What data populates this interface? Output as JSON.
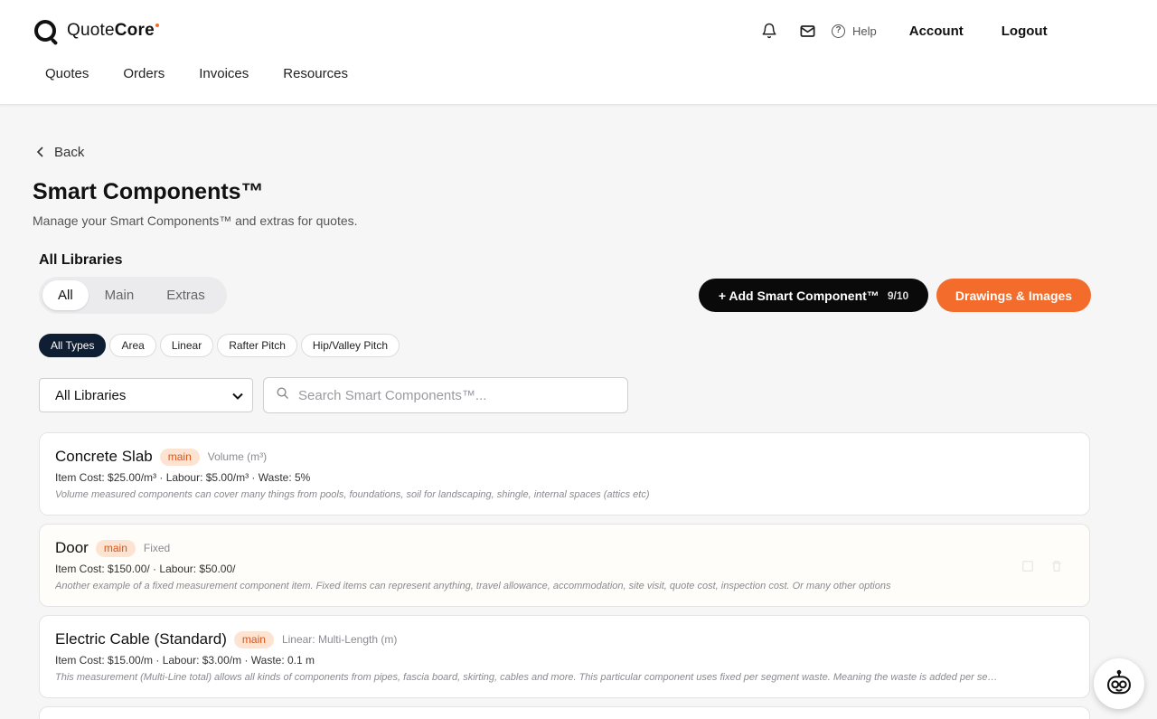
{
  "brand": {
    "name_light": "Quote",
    "name_bold": "Core"
  },
  "header": {
    "help_label": "Help",
    "account_label": "Account",
    "logout_label": "Logout"
  },
  "nav": [
    "Quotes",
    "Orders",
    "Invoices",
    "Resources"
  ],
  "page": {
    "back_label": "Back",
    "title": "Smart Components™",
    "subtitle": "Manage your Smart Components™ and extras for quotes.",
    "libraries_heading": "All Libraries"
  },
  "segment_tabs": [
    {
      "label": "All",
      "active": true
    },
    {
      "label": "Main",
      "active": false
    },
    {
      "label": "Extras",
      "active": false
    }
  ],
  "actions": {
    "add_label": "+ Add Smart Component™",
    "add_count": "9/10",
    "drawings_label": "Drawings & Images"
  },
  "type_filters": [
    {
      "label": "All Types",
      "active": true
    },
    {
      "label": "Area",
      "active": false
    },
    {
      "label": "Linear",
      "active": false
    },
    {
      "label": "Rafter Pitch",
      "active": false
    },
    {
      "label": "Hip/Valley Pitch",
      "active": false
    }
  ],
  "library_select": {
    "value": "All Libraries"
  },
  "search": {
    "placeholder": "Search Smart Components™..."
  },
  "components": [
    {
      "name": "Concrete Slab",
      "badge": "main",
      "type": "Volume (m³)",
      "cost": "Item Cost: $25.00/m³ · Labour: $5.00/m³ · Waste: 5%",
      "description": "Volume measured components can cover many things from pools, foundations, soil for landscaping, shingle, internal spaces (attics etc)"
    },
    {
      "name": "Door",
      "badge": "main",
      "type": "Fixed",
      "cost": "Item Cost: $150.00/ · Labour: $50.00/",
      "description": "Another example of a fixed measurement component item. Fixed items can represent anything, travel allowance, accommodation, site visit, quote cost, inspection cost. Or many other options"
    },
    {
      "name": "Electric Cable (Standard)",
      "badge": "main",
      "type": "Linear: Multi-Length (m)",
      "cost": "Item Cost: $15.00/m · Labour: $3.00/m · Waste: 0.1 m",
      "description": "This measurement (Multi-Line total) allows all kinds of components from pipes, fascia board, skirting, cables and more. This particular component uses fixed per segment waste. Meaning the waste is added per segment"
    }
  ],
  "colors": {
    "accent": "#f36c2b",
    "primary_button": "#0a0a0a",
    "active_chip": "#0f1e33",
    "badge_bg": "#fde4d2",
    "badge_text": "#d9541a"
  },
  "icons": [
    "bell-icon",
    "mail-icon",
    "help-circle-icon",
    "chevron-left-icon",
    "chevron-down-icon",
    "search-icon",
    "assistant-bot-icon"
  ]
}
